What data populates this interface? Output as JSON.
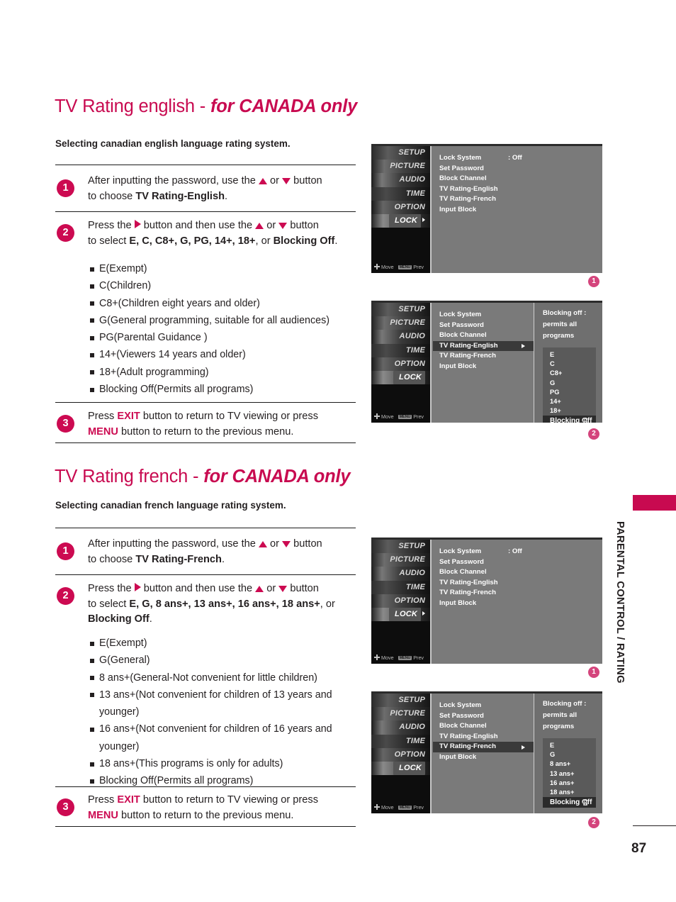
{
  "page": {
    "number": "87",
    "side_tab_label": "PARENTAL CONTROL / RATING"
  },
  "sections": [
    {
      "title_normal": "TV Rating english - ",
      "title_italic": "for CANADA only",
      "subtitle": "Selecting canadian english language rating system.",
      "steps": [
        {
          "badge": "1",
          "line1_pre": "After inputting the password, use the ",
          "line1_mid": " or ",
          "line1_post": " button",
          "line2_pre": "to choose ",
          "line2_bold": "TV Rating-English",
          "line2_post": "."
        },
        {
          "badge": "2",
          "line1_pre": "Press the ",
          "line1_post": " button and then use the ",
          "line1_mid2": " or ",
          "line1_end": " button",
          "line2_pre": "to select ",
          "options_bold": "E, C, C8+, G, PG, 14+, 18+",
          "line2_mid": ", or ",
          "line2_bold2": "Blocking Off",
          "line2_post": "."
        }
      ],
      "bullets": [
        "E(Exempt)",
        "C(Children)",
        "C8+(Children eight years and older)",
        "G(General programming, suitable for all audiences)",
        "PG(Parental Guidance )",
        "14+(Viewers 14 years and older)",
        "18+(Adult programming)",
        "Blocking Off(Permits all programs)"
      ],
      "step3": {
        "badge": "3",
        "l1_a": "Press ",
        "l1_key": "EXIT",
        "l1_b": " button to return to TV viewing or press",
        "l2_key": "MENU",
        "l2_b": " button to return to the previous menu."
      }
    },
    {
      "title_normal": "TV Rating french - ",
      "title_italic": "for CANADA only",
      "subtitle": "Selecting canadian french language rating system.",
      "steps": [
        {
          "badge": "1",
          "line1_pre": "After inputting the password, use the ",
          "line1_mid": " or ",
          "line1_post": " button",
          "line2_pre": "to choose ",
          "line2_bold": "TV Rating-French",
          "line2_post": "."
        },
        {
          "badge": "2",
          "line1_pre": "Press the ",
          "line1_post": " button and then use the ",
          "line1_mid2": " or ",
          "line1_end": " button",
          "line2_pre": "to select ",
          "options_bold": "E, G, 8 ans+, 13 ans+, 16 ans+, 18 ans+",
          "line2_mid": ", or",
          "line3_bold": "Blocking Off",
          "line3_post": "."
        }
      ],
      "bullets": [
        "E(Exempt)",
        "G(General)",
        "8 ans+(General-Not convenient for little children)",
        "13 ans+(Not convenient for children of 13 years and younger)",
        "16 ans+(Not convenient for children of 16 years and younger)",
        "18 ans+(This programs is only for adults)",
        "Blocking Off(Permits all programs)"
      ],
      "step3": {
        "badge": "3",
        "l1_a": "Press ",
        "l1_key": "EXIT",
        "l1_b": " button to return to TV viewing or press",
        "l2_key": "MENU",
        "l2_b": " button to return to the previous menu."
      }
    }
  ],
  "osd": {
    "rail_items": [
      "SETUP",
      "PICTURE",
      "AUDIO",
      "TIME",
      "OPTION",
      "LOCK"
    ],
    "rail_selected": "LOCK",
    "footer_move": "Move",
    "footer_key": "MENU",
    "footer_prev": "Prev",
    "menu_items": [
      "Lock System",
      "Set Password",
      "Block Channel",
      "TV Rating-English",
      "TV Rating-French",
      "Input Block"
    ],
    "lock_system_value": ": Off"
  },
  "figures": [
    {
      "badge": "1",
      "highlight": null,
      "lock_value": ": Off",
      "panel": null
    },
    {
      "badge": "2",
      "highlight": "TV Rating-English",
      "lock_value": "",
      "panel": {
        "caption": "Blocking off : permits all programs",
        "options": [
          "E",
          "C",
          "C8+",
          "G",
          "PG",
          "14+",
          "18+"
        ],
        "selected": "Blocking Off"
      }
    },
    {
      "badge": "1",
      "highlight": null,
      "lock_value": ": Off",
      "panel": null
    },
    {
      "badge": "2",
      "highlight": "TV Rating-French",
      "lock_value": "",
      "panel": {
        "caption": "Blocking off : permits all programs",
        "options": [
          "E",
          "G",
          "8 ans+",
          "13 ans+",
          "16 ans+",
          "18 ans+"
        ],
        "selected": "Blocking Off"
      }
    }
  ]
}
